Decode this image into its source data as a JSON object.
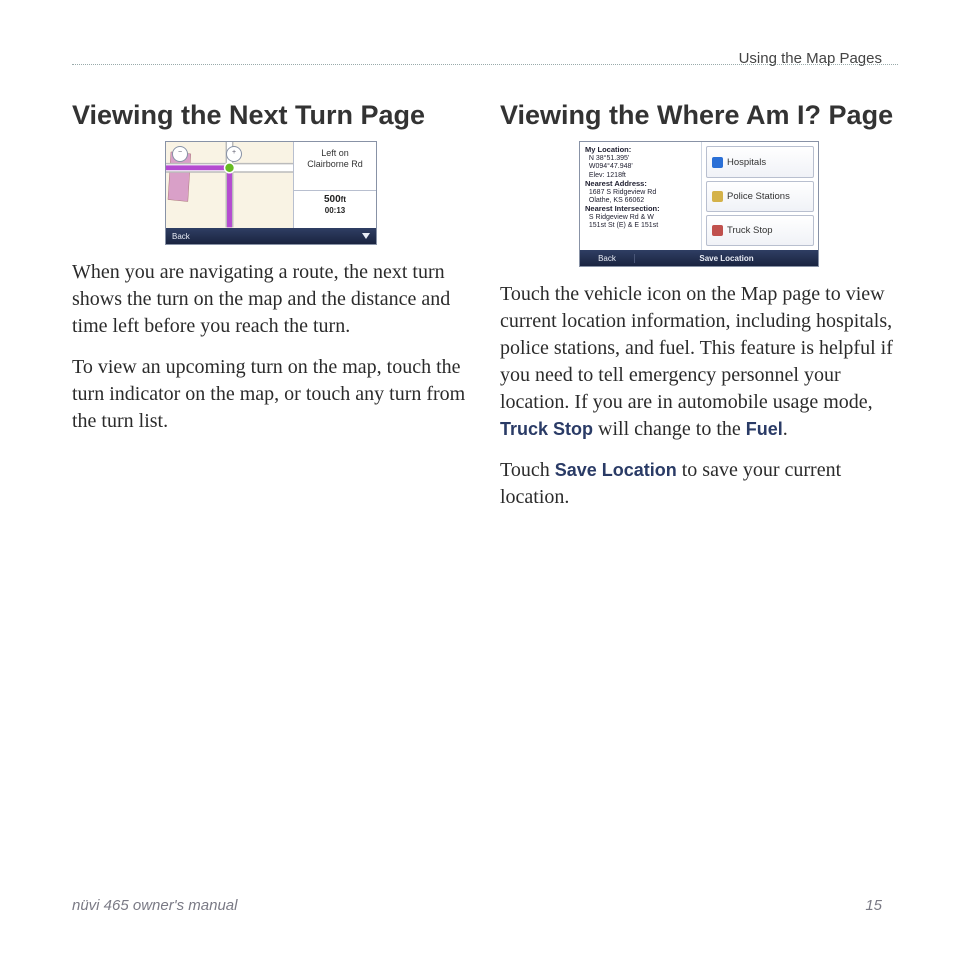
{
  "running_head": "Using the Map Pages",
  "left": {
    "heading": "Viewing the Next Turn Page",
    "shot": {
      "instruction": "Left on Clairborne Rd",
      "distance": "500",
      "distance_unit": "ft",
      "time": "00:13",
      "back": "Back"
    },
    "p1": "When you are navigating a route, the next turn shows the turn on the map and the distance and time left before you reach the turn.",
    "p2": "To view an upcoming turn on the map, touch the turn indicator on the map, or touch any turn from the turn list."
  },
  "right": {
    "heading": "Viewing the Where Am I? Page",
    "shot": {
      "loc_label": "My Location:",
      "lat": "N 38°51.395'",
      "lon": "W094°47.948'",
      "elev": "Elev:  1218ft",
      "addr_label": "Nearest Address:",
      "addr1": "1687 S Ridgeview Rd",
      "addr2": "Olathe, KS 66062",
      "int_label": "Nearest Intersection:",
      "int1": "S Ridgeview Rd & W",
      "int2": "151st St (E) & E 151st",
      "btn_hospitals": "Hospitals",
      "btn_police": "Police Stations",
      "btn_truck": "Truck Stop",
      "back": "Back",
      "save": "Save Location"
    },
    "p1a": "Touch the vehicle icon on the Map page to view current location information, including hospitals, police stations, and fuel. This feature is helpful if you need to tell emergency personnel your location. If you are in automobile usage mode, ",
    "p1_truck": "Truck Stop",
    "p1b": " will change to the ",
    "p1_fuel": "Fuel",
    "p1c": ".",
    "p2a": " Touch ",
    "p2_save": "Save Location",
    "p2b": " to save your current location."
  },
  "footer": {
    "left": "nüvi 465 owner's manual",
    "right": "15"
  }
}
